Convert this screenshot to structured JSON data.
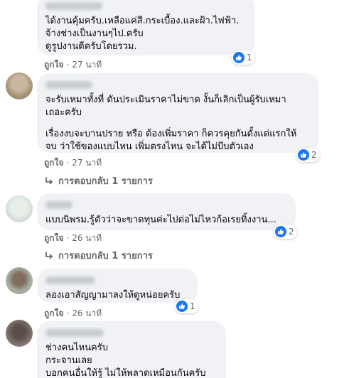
{
  "like_color": "#1877f2",
  "comments": [
    {
      "lines": [
        "ได้งานคุ้มครับ.เหลือแค่สี.กระเบื้อง.และฝ้า.ไฟฟ้า.",
        "จ้างช่างเป็นงานๆไป.ครับ",
        "ดูรูปงานดีครับโดยรวม."
      ],
      "reactions": "1",
      "like_label": "ถูกใจ",
      "time": "27 นาที"
    },
    {
      "lines": [
        "จะรับเหมาทั้งที่ ดันประเมินราคาไม่ขาด งั้นก็เลิกเป็นผู้รับเหมา",
        "เถอะครับ"
      ],
      "lines2": [
        "เรื่องงบจะบานปราย หรือ ต้องเพิ่มราคา ก็ควรคุยกันตั้งแต่แรกให้",
        "จบ ว่าใช้ของแบบไหน เพิ่มตรงไหน จะได้ไม่บีบตัวเอง"
      ],
      "reactions": "2",
      "like_label": "ถูกใจ",
      "time": "27 นาที",
      "replies_label": "การตอบกลับ 1 รายการ"
    },
    {
      "lines": [
        "แบบนิพรม.รู้ตัวว่าจะขาดทุนค่ะไปต่อไม่ไหวก้อเรยทิ้งงาน..."
      ],
      "reactions": "2",
      "like_label": "ถูกใจ",
      "time": "26 นาที",
      "replies_label": "การตอบกลับ 1 รายการ"
    },
    {
      "lines": [
        "ลองเอาสัญญามาลงให้ดูหน่อยครับ"
      ],
      "reactions": "1",
      "like_label": "ถูกใจ",
      "time": "26 นาที"
    },
    {
      "lines": [
        "ช่างคนไหนครับ",
        "กระจานเลย",
        "บอกคนอื่นให้รู้ ไม่ให้พลาดเหมือนกันครับ"
      ]
    }
  ]
}
